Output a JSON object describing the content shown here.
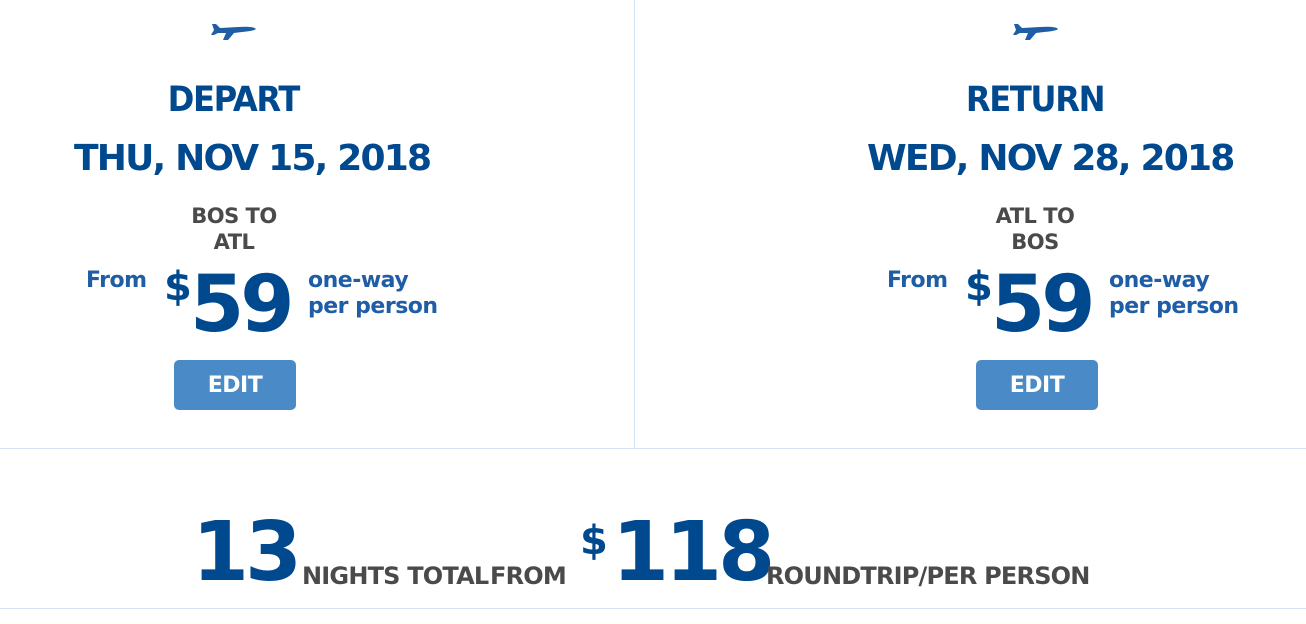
{
  "depart": {
    "icon": "plane-icon",
    "title": "DEPART",
    "date": "THU, NOV 15, 2018",
    "route_line1": "BOS TO",
    "route_line2": "ATL",
    "from_label": "From",
    "currency": "$",
    "price": "59",
    "desc_line1": "one-way",
    "desc_line2": "per person",
    "edit_label": "EDIT"
  },
  "return": {
    "icon": "plane-icon",
    "title": "RETURN",
    "date": "WED, NOV 28, 2018",
    "route_line1": "ATL TO",
    "route_line2": "BOS",
    "from_label": "From",
    "currency": "$",
    "price": "59",
    "desc_line1": "one-way",
    "desc_line2": "per person",
    "edit_label": "EDIT"
  },
  "summary": {
    "nights": "13",
    "nights_label": "NIGHTS TOTAL",
    "from_label": "FROM",
    "currency": "$",
    "total_price": "118",
    "roundtrip_label": "ROUNDTRIP/PER PERSON"
  },
  "colors": {
    "primary": "#00498f",
    "secondary": "#1f5ea6",
    "button": "#4a8bc7",
    "text_gray": "#4a4a4a",
    "divider": "#d4e3f2"
  }
}
